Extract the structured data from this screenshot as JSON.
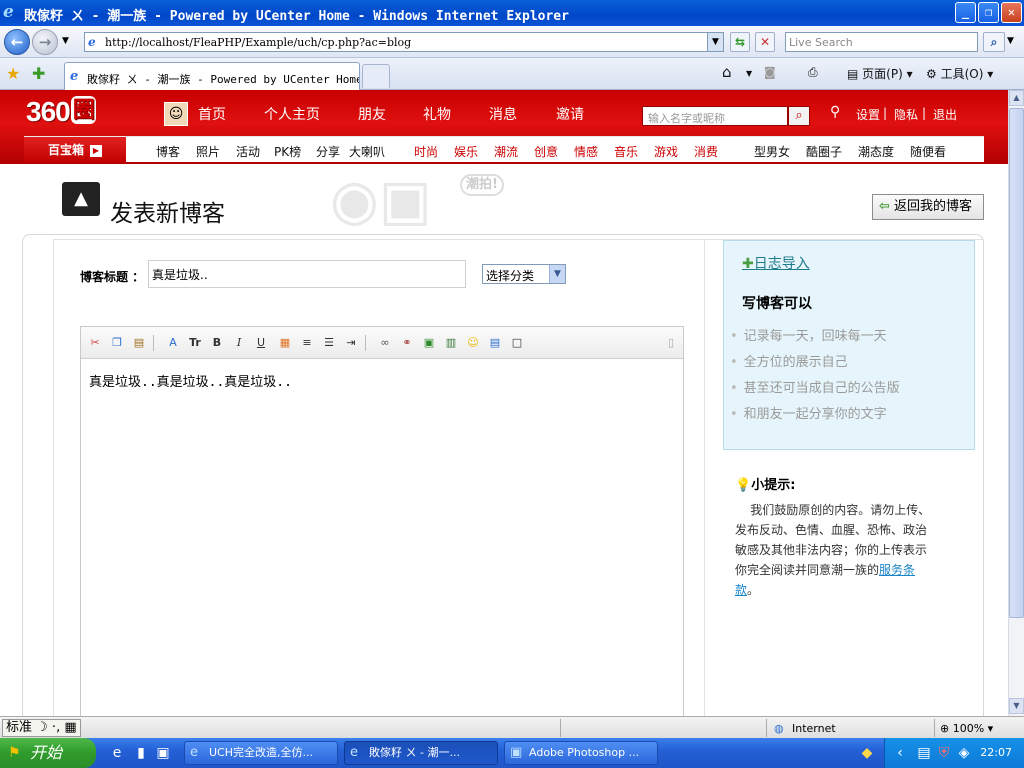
{
  "window": {
    "title": "敗傢籽 ㄨ - 潮一族 - Powered by UCenter Home - Windows Internet Explorer",
    "min": "_",
    "max": "❐",
    "close": "✕"
  },
  "addressbar": {
    "url": "http://localhost/FleaPHP/Example/uch/cp.php?ac=blog",
    "search_placeholder": "Live Search"
  },
  "tab": {
    "title": "敗傢籽 ㄨ - 潮一族 - Powered by UCenter Home"
  },
  "commandbar": {
    "page": "页面(P)",
    "tools": "工具(O)"
  },
  "site": {
    "logo": "360",
    "logo_mark": "圈",
    "nav": [
      "首页",
      "个人主页",
      "朋友",
      "礼物",
      "消息",
      "邀请"
    ],
    "search_placeholder": "输入名字或昵称",
    "links": [
      "设置",
      "隐私",
      "退出"
    ],
    "baobox": "百宝箱",
    "subnav_black": [
      "博客",
      "照片",
      "活动",
      "PK榜",
      "分享",
      "大喇叭"
    ],
    "subnav_red": [
      "时尚",
      "娱乐",
      "潮流",
      "创意",
      "情感",
      "音乐",
      "游戏",
      "消费"
    ],
    "subnav_right": [
      "型男女",
      "酷圈子",
      "潮态度",
      "随便看"
    ]
  },
  "page": {
    "heading": "发表新博客",
    "deco_tag": "潮拍!",
    "back_button": "返回我的博客",
    "title_label": "博客标题 ：",
    "title_value": "真是垃圾..",
    "category_label": "选择分类",
    "editor_content": "真是垃圾..真是垃圾..真是垃圾..",
    "toolbar_labels": {
      "font": "Tr",
      "bold": "B",
      "italic": "I",
      "underline": "U"
    }
  },
  "sidebar": {
    "import_link": "日志导入",
    "heading": "写博客可以",
    "items": [
      "记录每一天，回味每一天",
      "全方位的展示自己",
      "甚至还可当成自己的公告版",
      "和朋友一起分享你的文字"
    ],
    "tip_heading": "小提示:",
    "tip_text": "我们鼓励原创的内容。请勿上传、发布反动、色情、血腥、恐怖、政治敏感及其他非法内容；你的上传表示你完全阅读并同意潮一族的",
    "tip_link": "服务条款",
    "tip_end": "。"
  },
  "statusbar": {
    "ime": "标准",
    "zone": "Internet",
    "zoom": "100%"
  },
  "taskbar": {
    "start": "开始",
    "tasks": [
      "UCH完全改造,全仿...",
      "敗傢籽 ㄨ - 潮一...",
      "Adobe Photoshop ..."
    ],
    "clock": "22:07"
  },
  "colors": {
    "brand_red": "#c80000",
    "link_teal": "#1f7a8c",
    "info_bg": "#e6f5fb"
  }
}
